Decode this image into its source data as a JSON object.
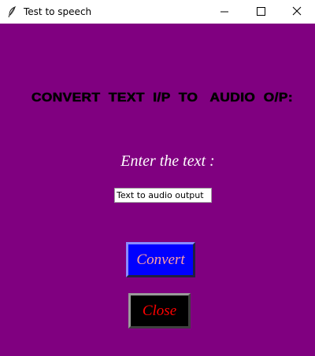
{
  "window": {
    "title": "Test to speech",
    "icon": "feather-icon",
    "controls": {
      "minimize": "minimize-icon",
      "maximize": "maximize-icon",
      "close": "close-icon"
    }
  },
  "colors": {
    "background": "#800080",
    "heading_text": "#000000",
    "prompt_text": "#ffffff",
    "convert_bg": "#0000ff",
    "convert_text": "#ffa0a0",
    "close_bg": "#000000",
    "close_text": "#ff0000"
  },
  "main": {
    "heading": "CONVERT  TEXT  I/P  TO   AUDIO  O/P:",
    "prompt": "Enter the text :",
    "input_value": "Text to audio output",
    "convert_label": "Convert",
    "close_label": "Close"
  }
}
